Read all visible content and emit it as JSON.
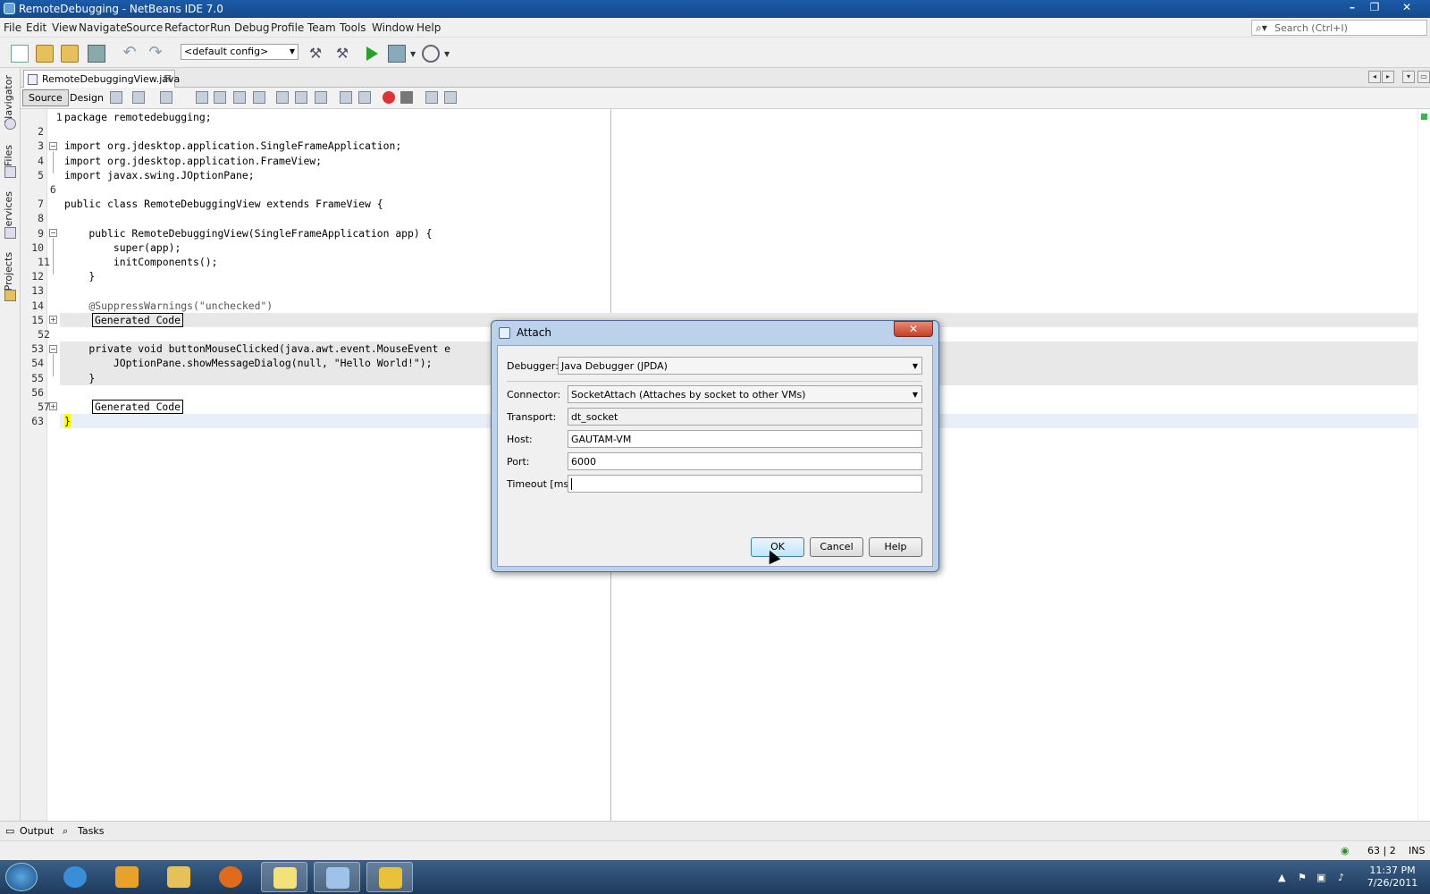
{
  "window": {
    "title": "RemoteDebugging - NetBeans IDE 7.0"
  },
  "menu": [
    "File",
    "Edit",
    "View",
    "Navigate",
    "Source",
    "Refactor",
    "Run",
    "Debug",
    "Profile",
    "Team",
    "Tools",
    "Window",
    "Help"
  ],
  "search": {
    "placeholder": "Search (Ctrl+I)"
  },
  "toolbar": {
    "config": "<default config>"
  },
  "side_tabs": [
    "Navigator",
    "Files",
    "Services",
    "Projects"
  ],
  "editor": {
    "file_tab": "RemoteDebuggingView.java",
    "view_tabs": [
      "Source",
      "Design"
    ],
    "active_view": "Source",
    "lines": [
      {
        "n": "1",
        "text": "package remotedebugging;"
      },
      {
        "n": "2",
        "text": ""
      },
      {
        "n": "3",
        "text": "import org.jdesktop.application.SingleFrameApplication;"
      },
      {
        "n": "4",
        "text": "import org.jdesktop.application.FrameView;"
      },
      {
        "n": "5",
        "text": "import javax.swing.JOptionPane;"
      },
      {
        "n": "6",
        "text": ""
      },
      {
        "n": "7",
        "text": "public class RemoteDebuggingView extends FrameView {"
      },
      {
        "n": "8",
        "text": ""
      },
      {
        "n": "9",
        "text": "    public RemoteDebuggingView(SingleFrameApplication app) {"
      },
      {
        "n": "10",
        "text": "        super(app);"
      },
      {
        "n": "11",
        "text": "        initComponents();"
      },
      {
        "n": "12",
        "text": "    }"
      },
      {
        "n": "13",
        "text": ""
      },
      {
        "n": "14",
        "text": "    @SuppressWarnings(\"unchecked\")"
      },
      {
        "n": "15",
        "text": "Generated Code"
      },
      {
        "n": "52",
        "text": ""
      },
      {
        "n": "53",
        "text": "    private void buttonMouseClicked(java.awt.event.MouseEvent e"
      },
      {
        "n": "54",
        "text": "        JOptionPane.showMessageDialog(null, \"Hello World!\");"
      },
      {
        "n": "55",
        "text": "    }"
      },
      {
        "n": "56",
        "text": ""
      },
      {
        "n": "57",
        "text": "Generated Code"
      },
      {
        "n": "63",
        "text": "}"
      }
    ]
  },
  "bottom_tabs": [
    "Output",
    "Tasks"
  ],
  "status": {
    "position": "63 | 2",
    "mode": "INS"
  },
  "dialog": {
    "title": "Attach",
    "debugger_label": "Debugger:",
    "debugger_value": "Java Debugger (JPDA)",
    "connector_label": "Connector:",
    "connector_value": "SocketAttach (Attaches by socket to other VMs)",
    "transport_label": "Transport:",
    "transport_value": "dt_socket",
    "host_label": "Host:",
    "host_value": "GAUTAM-VM",
    "port_label": "Port:",
    "port_value": "6000",
    "timeout_label": "Timeout [ms]:",
    "timeout_value": "",
    "ok": "OK",
    "cancel": "Cancel",
    "help": "Help"
  },
  "taskbar": {
    "apps": [
      "internet-explorer",
      "media-player",
      "file-explorer",
      "firefox",
      "sticky-notes",
      "netbeans",
      "app-grid"
    ],
    "time": "11:37 PM",
    "date": "7/26/2011"
  }
}
